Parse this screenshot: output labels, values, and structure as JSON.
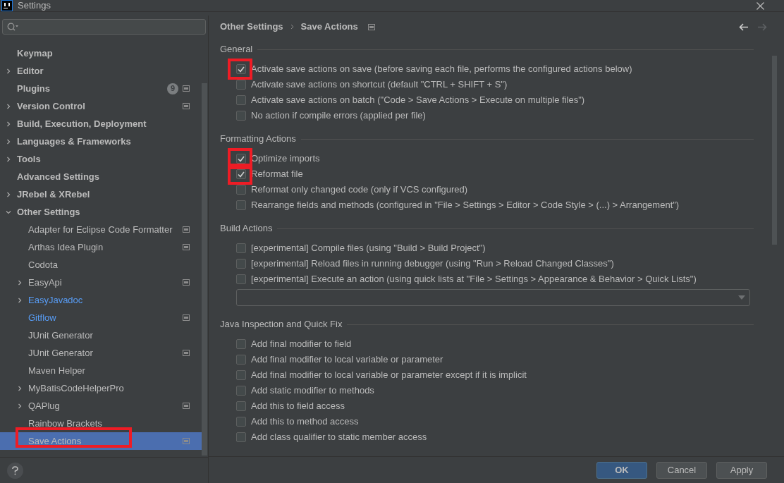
{
  "window": {
    "title": "Settings"
  },
  "sidebar": {
    "items": [
      {
        "label": "Keymap",
        "kind": "leaf",
        "selected": false,
        "highlighted": false
      },
      {
        "label": "Editor",
        "kind": "group",
        "expanded": false,
        "selected": false,
        "highlighted": false
      },
      {
        "label": "Plugins",
        "kind": "leaf",
        "badge": "9",
        "project_icon": true,
        "selected": false,
        "highlighted": false
      },
      {
        "label": "Version Control",
        "kind": "group",
        "expanded": false,
        "project_icon": true,
        "selected": false,
        "highlighted": false
      },
      {
        "label": "Build, Execution, Deployment",
        "kind": "group",
        "expanded": false,
        "selected": false,
        "highlighted": false
      },
      {
        "label": "Languages & Frameworks",
        "kind": "group",
        "expanded": false,
        "selected": false,
        "highlighted": false
      },
      {
        "label": "Tools",
        "kind": "group",
        "expanded": false,
        "selected": false,
        "highlighted": false
      },
      {
        "label": "Advanced Settings",
        "kind": "leaf",
        "selected": false,
        "highlighted": false
      },
      {
        "label": "JRebel & XRebel",
        "kind": "group",
        "expanded": false,
        "selected": false,
        "highlighted": false
      },
      {
        "label": "Other Settings",
        "kind": "group",
        "expanded": true,
        "selected": false,
        "highlighted": false,
        "children": [
          {
            "label": "Adapter for Eclipse Code Formatter",
            "kind": "leaf",
            "project_icon": true,
            "selected": false,
            "highlighted": false
          },
          {
            "label": "Arthas Idea Plugin",
            "kind": "leaf",
            "project_icon": true,
            "selected": false,
            "highlighted": false
          },
          {
            "label": "Codota",
            "kind": "leaf",
            "selected": false,
            "highlighted": false
          },
          {
            "label": "EasyApi",
            "kind": "group",
            "expanded": false,
            "project_icon": true,
            "selected": false,
            "highlighted": false
          },
          {
            "label": "EasyJavadoc",
            "kind": "group",
            "expanded": false,
            "color": "#589df6",
            "selected": false,
            "highlighted": false
          },
          {
            "label": "Gitflow",
            "kind": "leaf",
            "color": "#589df6",
            "project_icon": true,
            "selected": false,
            "highlighted": false
          },
          {
            "label": "JUnit Generator",
            "kind": "leaf",
            "selected": false,
            "highlighted": false
          },
          {
            "label": "JUnit Generator",
            "kind": "leaf",
            "project_icon": true,
            "selected": false,
            "highlighted": false
          },
          {
            "label": "Maven Helper",
            "kind": "leaf",
            "selected": false,
            "highlighted": false
          },
          {
            "label": "MyBatisCodeHelperPro",
            "kind": "group",
            "expanded": false,
            "selected": false,
            "highlighted": false
          },
          {
            "label": "QAPlug",
            "kind": "group",
            "expanded": false,
            "project_icon": true,
            "selected": false,
            "highlighted": false
          },
          {
            "label": "Rainbow Brackets",
            "kind": "leaf",
            "selected": false,
            "highlighted": false
          },
          {
            "label": "Save Actions",
            "kind": "leaf",
            "project_icon": true,
            "selected": true,
            "highlighted": true
          }
        ]
      }
    ]
  },
  "header": {
    "breadcrumb": [
      "Other Settings",
      "Save Actions"
    ],
    "project_icon": true,
    "nav": [
      {
        "kind": "back",
        "disabled": false
      },
      {
        "kind": "forward",
        "disabled": true
      }
    ]
  },
  "sections": [
    {
      "title": "General",
      "items": [
        {
          "kind": "checkbox",
          "label": "Activate save actions on save (before saving each file, performs the configured actions below)",
          "checked": true,
          "highlighted": true
        },
        {
          "kind": "checkbox",
          "label": "Activate save actions on shortcut (default \"CTRL + SHIFT + S\")",
          "checked": false,
          "highlighted": false
        },
        {
          "kind": "checkbox",
          "label": "Activate save actions on batch (\"Code > Save Actions > Execute on multiple files\")",
          "checked": false,
          "highlighted": false
        },
        {
          "kind": "checkbox",
          "label": "No action if compile errors (applied per file)",
          "checked": false,
          "highlighted": false
        }
      ]
    },
    {
      "title": "Formatting Actions",
      "items": [
        {
          "kind": "checkbox",
          "label": "Optimize imports",
          "checked": true,
          "highlighted": true
        },
        {
          "kind": "checkbox",
          "label": "Reformat file",
          "checked": true,
          "highlighted": true
        },
        {
          "kind": "checkbox",
          "label": "Reformat only changed code (only if VCS configured)",
          "checked": false,
          "highlighted": false
        },
        {
          "kind": "checkbox",
          "label": "Rearrange fields and methods (configured in \"File > Settings > Editor > Code Style > (...) > Arrangement\")",
          "checked": false,
          "highlighted": false
        }
      ]
    },
    {
      "title": "Build Actions",
      "items": [
        {
          "kind": "checkbox",
          "label": "[experimental] Compile files (using \"Build > Build Project\")",
          "checked": false,
          "highlighted": false
        },
        {
          "kind": "checkbox",
          "label": "[experimental] Reload files in running debugger (using \"Run > Reload Changed Classes\")",
          "checked": false,
          "highlighted": false
        },
        {
          "kind": "checkbox",
          "label": "[experimental] Execute an action (using quick lists at \"File > Settings > Appearance & Behavior > Quick Lists\")",
          "checked": false,
          "highlighted": false
        },
        {
          "kind": "dropdown"
        }
      ]
    },
    {
      "title": "Java Inspection and Quick Fix",
      "items": [
        {
          "kind": "checkbox",
          "label": "Add final modifier to field",
          "checked": false,
          "highlighted": false
        },
        {
          "kind": "checkbox",
          "label": "Add final modifier to local variable or parameter",
          "checked": false,
          "highlighted": false
        },
        {
          "kind": "checkbox",
          "label": "Add final modifier to local variable or parameter except if it is implicit",
          "checked": false,
          "highlighted": false
        },
        {
          "kind": "checkbox",
          "label": "Add static modifier to methods",
          "checked": false,
          "highlighted": false
        },
        {
          "kind": "checkbox",
          "label": "Add this to field access",
          "checked": false,
          "highlighted": false
        },
        {
          "kind": "checkbox",
          "label": "Add this to method access",
          "checked": false,
          "highlighted": false
        },
        {
          "kind": "checkbox",
          "label": "Add class qualifier to static member access",
          "checked": false,
          "highlighted": false
        }
      ]
    }
  ],
  "buttons": [
    {
      "label": "OK",
      "primary": true
    },
    {
      "label": "Cancel",
      "primary": false
    },
    {
      "label": "Apply",
      "primary": false
    }
  ]
}
